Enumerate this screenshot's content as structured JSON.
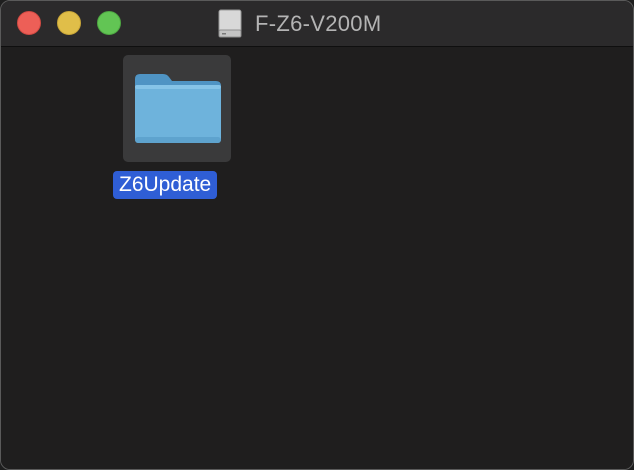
{
  "window": {
    "title": "F-Z6-V200M",
    "title_icon": "external-drive-icon"
  },
  "traffic_lights": {
    "close_color": "#ed5f57",
    "minimize_color": "#e0be49",
    "zoom_color": "#62c554"
  },
  "items": [
    {
      "name": "Z6Update",
      "icon": "folder-icon",
      "selected": true,
      "selection_color": "#2f5ed5"
    }
  ]
}
